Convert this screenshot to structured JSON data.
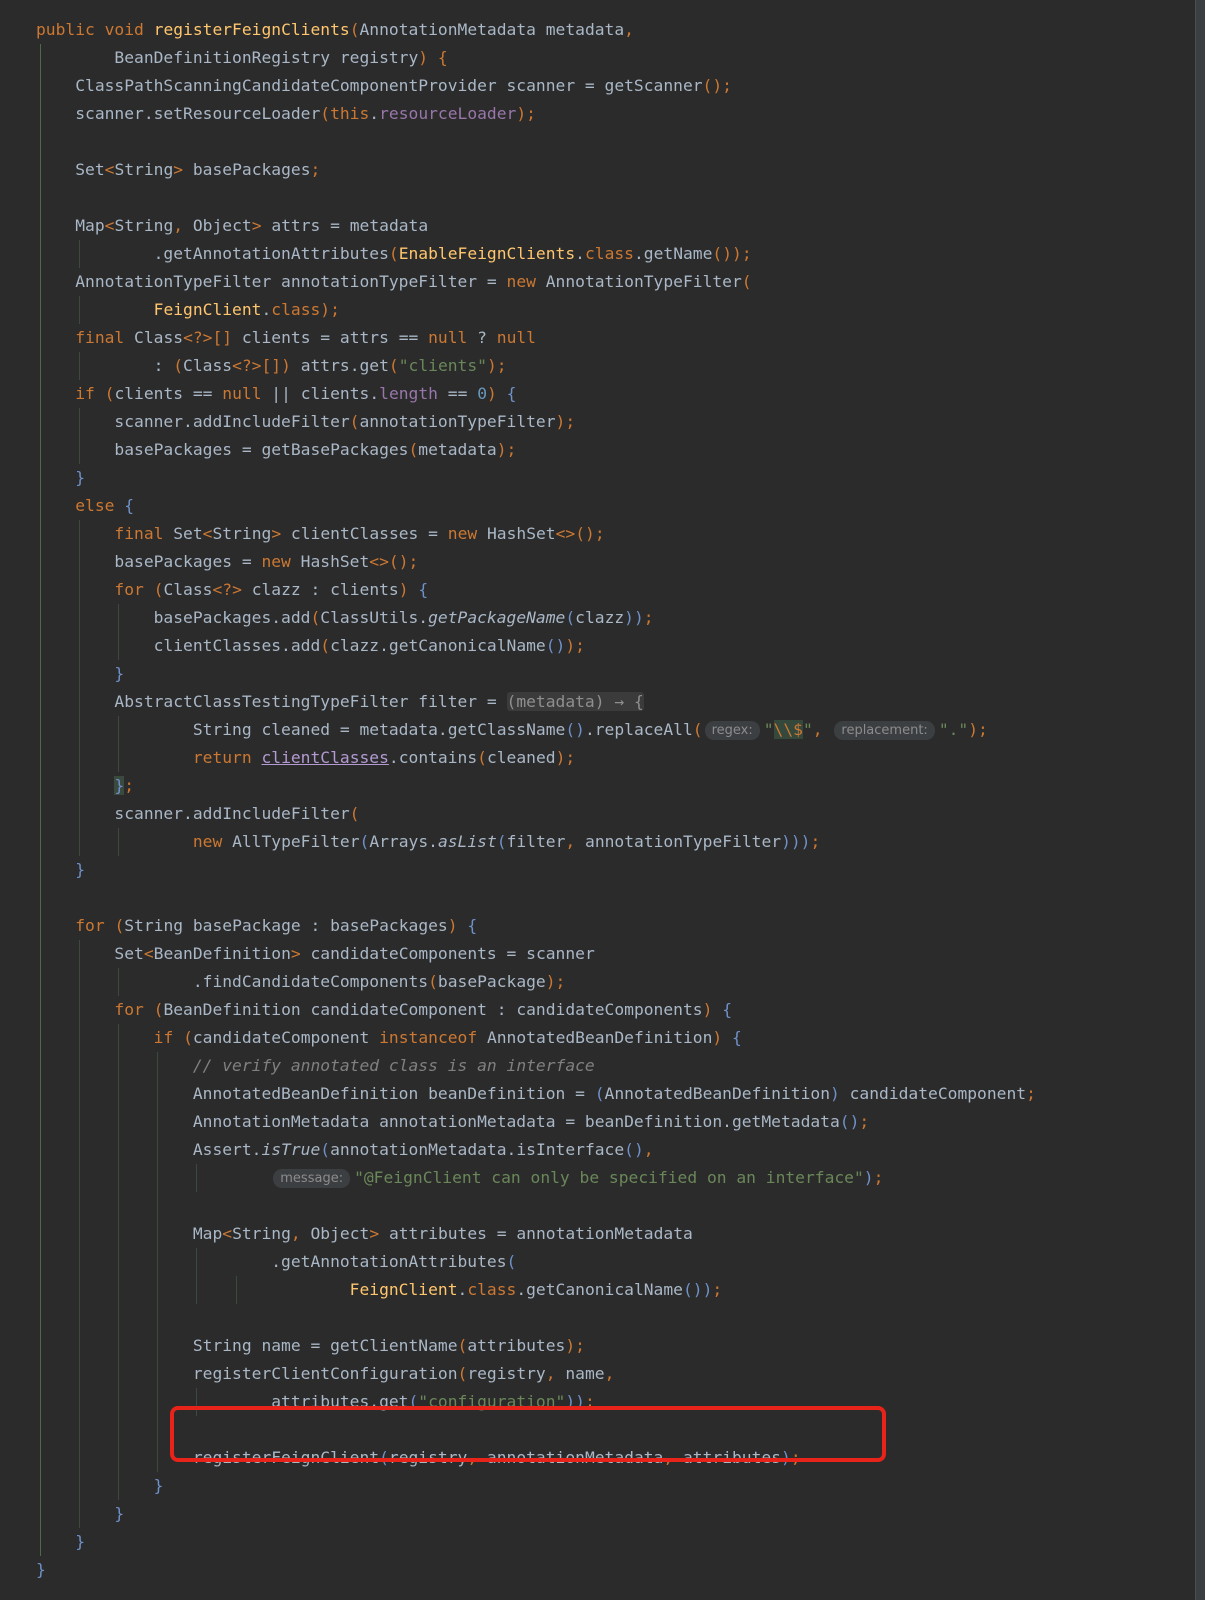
{
  "editor": {
    "theme_colors": {
      "background": "#2b2b2b",
      "keyword": "#cc7832",
      "method_declaration": "#ffc66d",
      "string": "#6a8759",
      "number": "#6897bb",
      "field": "#9876aa",
      "comment": "#808080",
      "default_text": "#a9b7c6",
      "highlight_box": "#e8241a"
    },
    "lines": [
      [
        {
          "t": "public void ",
          "c": "kw"
        },
        {
          "t": "registerFeignClients",
          "c": "fn"
        },
        {
          "t": "(",
          "c": "pc"
        },
        {
          "t": "AnnotationMetadata metadata",
          "c": ""
        },
        {
          "t": ",",
          "c": "pc"
        }
      ],
      [
        {
          "t": "        BeanDefinitionRegistry registry",
          "c": ""
        },
        {
          "t": ") {",
          "c": "pc"
        }
      ],
      [
        {
          "t": "    ClassPathScanningCandidateComponentProvider scanner = getScanner",
          "c": ""
        },
        {
          "t": "();",
          "c": "pc"
        }
      ],
      [
        {
          "t": "    scanner.setResourceLoader",
          "c": ""
        },
        {
          "t": "(",
          "c": "pc"
        },
        {
          "t": "this",
          "c": "kw"
        },
        {
          "t": ".",
          "c": ""
        },
        {
          "t": "resourceLoader",
          "c": "fld"
        },
        {
          "t": ");",
          "c": "pc"
        }
      ],
      [],
      [
        {
          "t": "    Set",
          "c": ""
        },
        {
          "t": "<",
          "c": "pc"
        },
        {
          "t": "String",
          "c": ""
        },
        {
          "t": ">",
          "c": "pc"
        },
        {
          "t": " basePackages",
          "c": ""
        },
        {
          "t": ";",
          "c": "pc"
        }
      ],
      [],
      [
        {
          "t": "    Map",
          "c": ""
        },
        {
          "t": "<",
          "c": "pc"
        },
        {
          "t": "String",
          "c": ""
        },
        {
          "t": ",",
          "c": "pc"
        },
        {
          "t": " Object",
          "c": ""
        },
        {
          "t": ">",
          "c": "pc"
        },
        {
          "t": " attrs = metadata",
          "c": ""
        }
      ],
      [
        {
          "t": "            .getAnnotationAttributes",
          "c": ""
        },
        {
          "t": "(",
          "c": "pc"
        },
        {
          "t": "EnableFeignClients",
          "c": "fn"
        },
        {
          "t": ".",
          "c": ""
        },
        {
          "t": "class",
          "c": "kw"
        },
        {
          "t": ".getName",
          "c": ""
        },
        {
          "t": "());",
          "c": "pc"
        }
      ],
      [
        {
          "t": "    AnnotationTypeFilter annotationTypeFilter = ",
          "c": ""
        },
        {
          "t": "new ",
          "c": "kw"
        },
        {
          "t": "AnnotationTypeFilter",
          "c": ""
        },
        {
          "t": "(",
          "c": "pc"
        }
      ],
      [
        {
          "t": "            ",
          "c": ""
        },
        {
          "t": "FeignClient",
          "c": "fn"
        },
        {
          "t": ".",
          "c": ""
        },
        {
          "t": "class",
          "c": "kw"
        },
        {
          "t": ");",
          "c": "pc"
        }
      ],
      [
        {
          "t": "    ",
          "c": ""
        },
        {
          "t": "final ",
          "c": "kw"
        },
        {
          "t": "Class",
          "c": ""
        },
        {
          "t": "<?>[]",
          "c": "pc"
        },
        {
          "t": " clients = attrs == ",
          "c": ""
        },
        {
          "t": "null",
          "c": "kw"
        },
        {
          "t": " ? ",
          "c": ""
        },
        {
          "t": "null",
          "c": "kw"
        }
      ],
      [
        {
          "t": "            : ",
          "c": ""
        },
        {
          "t": "(",
          "c": "pc"
        },
        {
          "t": "Class",
          "c": ""
        },
        {
          "t": "<?>[]",
          "c": "pc"
        },
        {
          "t": ")",
          "c": "pc"
        },
        {
          "t": " attrs.get",
          "c": ""
        },
        {
          "t": "(",
          "c": "pc"
        },
        {
          "t": "\"clients\"",
          "c": "str"
        },
        {
          "t": ");",
          "c": "pc"
        }
      ],
      [
        {
          "t": "    ",
          "c": ""
        },
        {
          "t": "if ",
          "c": "kw"
        },
        {
          "t": "(",
          "c": "pc"
        },
        {
          "t": "clients == ",
          "c": ""
        },
        {
          "t": "null",
          "c": "kw"
        },
        {
          "t": " || clients.",
          "c": ""
        },
        {
          "t": "length",
          "c": "fld"
        },
        {
          "t": " == ",
          "c": ""
        },
        {
          "t": "0",
          "c": "num"
        },
        {
          "t": ") ",
          "c": "pc"
        },
        {
          "t": "{",
          "c": "pb"
        }
      ],
      [
        {
          "t": "        scanner.addIncludeFilter",
          "c": ""
        },
        {
          "t": "(",
          "c": "pc"
        },
        {
          "t": "annotationTypeFilter",
          "c": ""
        },
        {
          "t": ");",
          "c": "pc"
        }
      ],
      [
        {
          "t": "        basePackages = getBasePackages",
          "c": ""
        },
        {
          "t": "(",
          "c": "pc"
        },
        {
          "t": "metadata",
          "c": ""
        },
        {
          "t": ");",
          "c": "pc"
        }
      ],
      [
        {
          "t": "    ",
          "c": ""
        },
        {
          "t": "}",
          "c": "pb"
        }
      ],
      [
        {
          "t": "    ",
          "c": ""
        },
        {
          "t": "else ",
          "c": "kw"
        },
        {
          "t": "{",
          "c": "pb"
        }
      ],
      [
        {
          "t": "        ",
          "c": ""
        },
        {
          "t": "final ",
          "c": "kw"
        },
        {
          "t": "Set",
          "c": ""
        },
        {
          "t": "<",
          "c": "pc"
        },
        {
          "t": "String",
          "c": ""
        },
        {
          "t": ">",
          "c": "pc"
        },
        {
          "t": " clientClasses = ",
          "c": ""
        },
        {
          "t": "new ",
          "c": "kw"
        },
        {
          "t": "HashSet",
          "c": ""
        },
        {
          "t": "<>();",
          "c": "pc"
        }
      ],
      [
        {
          "t": "        basePackages = ",
          "c": ""
        },
        {
          "t": "new ",
          "c": "kw"
        },
        {
          "t": "HashSet",
          "c": ""
        },
        {
          "t": "<>();",
          "c": "pc"
        }
      ],
      [
        {
          "t": "        ",
          "c": ""
        },
        {
          "t": "for ",
          "c": "kw"
        },
        {
          "t": "(",
          "c": "pc"
        },
        {
          "t": "Class",
          "c": ""
        },
        {
          "t": "<?>",
          "c": "pc"
        },
        {
          "t": " clazz : clients",
          "c": ""
        },
        {
          "t": ") ",
          "c": "pc"
        },
        {
          "t": "{",
          "c": "pb"
        }
      ],
      [
        {
          "t": "            basePackages.add",
          "c": ""
        },
        {
          "t": "(",
          "c": "pc"
        },
        {
          "t": "ClassUtils.",
          "c": ""
        },
        {
          "t": "getPackageName",
          "c": "it"
        },
        {
          "t": "(",
          "c": "pb"
        },
        {
          "t": "clazz",
          "c": ""
        },
        {
          "t": "))",
          "c": "pb"
        },
        {
          "t": ";",
          "c": "pc"
        }
      ],
      [
        {
          "t": "            clientClasses.add",
          "c": ""
        },
        {
          "t": "(",
          "c": "pc"
        },
        {
          "t": "clazz.getCanonicalName",
          "c": ""
        },
        {
          "t": "()",
          "c": "pb"
        },
        {
          "t": ");",
          "c": "pc"
        }
      ],
      [
        {
          "t": "        ",
          "c": ""
        },
        {
          "t": "}",
          "c": "pb"
        }
      ],
      [
        {
          "t": "        AbstractClassTestingTypeFilter filter = ",
          "c": ""
        },
        {
          "t": "(metadata) → {",
          "c": "lam"
        }
      ],
      [
        {
          "t": "                String cleaned = metadata.getClassName",
          "c": ""
        },
        {
          "t": "()",
          "c": "pb"
        },
        {
          "t": ".replaceAll",
          "c": ""
        },
        {
          "t": "(",
          "c": "pc"
        },
        {
          "h": "regex:"
        },
        {
          "t": "\"",
          "c": "str"
        },
        {
          "t": "\\\\$",
          "c": "esc"
        },
        {
          "t": "\"",
          "c": "str"
        },
        {
          "t": ", ",
          "c": "pc"
        },
        {
          "h": "replacement:"
        },
        {
          "t": "\".\"",
          "c": "str"
        },
        {
          "t": ");",
          "c": "pc"
        }
      ],
      [
        {
          "t": "                ",
          "c": ""
        },
        {
          "t": "return ",
          "c": "kw"
        },
        {
          "t": "clientClasses",
          "c": "ul"
        },
        {
          "t": ".contains",
          "c": ""
        },
        {
          "t": "(",
          "c": "pc"
        },
        {
          "t": "cleaned",
          "c": ""
        },
        {
          "t": ");",
          "c": "pc"
        }
      ],
      [
        {
          "t": "        ",
          "c": ""
        },
        {
          "t": "}",
          "c": "bh"
        },
        {
          "t": ";",
          "c": "pc"
        }
      ],
      [
        {
          "t": "        scanner.addIncludeFilter",
          "c": ""
        },
        {
          "t": "(",
          "c": "pc"
        }
      ],
      [
        {
          "t": "                ",
          "c": ""
        },
        {
          "t": "new ",
          "c": "kw"
        },
        {
          "t": "AllTypeFilter",
          "c": ""
        },
        {
          "t": "(",
          "c": "pb"
        },
        {
          "t": "Arrays.",
          "c": ""
        },
        {
          "t": "asList",
          "c": "it"
        },
        {
          "t": "(",
          "c": "pb"
        },
        {
          "t": "filter",
          "c": ""
        },
        {
          "t": ", ",
          "c": "pc"
        },
        {
          "t": "annotationTypeFilter",
          "c": ""
        },
        {
          "t": ")))",
          "c": "pb"
        },
        {
          "t": ";",
          "c": "pc"
        }
      ],
      [
        {
          "t": "    ",
          "c": ""
        },
        {
          "t": "}",
          "c": "pb"
        }
      ],
      [],
      [
        {
          "t": "    ",
          "c": ""
        },
        {
          "t": "for ",
          "c": "kw"
        },
        {
          "t": "(",
          "c": "pc"
        },
        {
          "t": "String basePackage : basePackages",
          "c": ""
        },
        {
          "t": ") ",
          "c": "pc"
        },
        {
          "t": "{",
          "c": "pb"
        }
      ],
      [
        {
          "t": "        Set",
          "c": ""
        },
        {
          "t": "<",
          "c": "pc"
        },
        {
          "t": "BeanDefinition",
          "c": ""
        },
        {
          "t": ">",
          "c": "pc"
        },
        {
          "t": " candidateComponents = scanner",
          "c": ""
        }
      ],
      [
        {
          "t": "                .findCandidateComponents",
          "c": ""
        },
        {
          "t": "(",
          "c": "pc"
        },
        {
          "t": "basePackage",
          "c": ""
        },
        {
          "t": ");",
          "c": "pc"
        }
      ],
      [
        {
          "t": "        ",
          "c": ""
        },
        {
          "t": "for ",
          "c": "kw"
        },
        {
          "t": "(",
          "c": "pc"
        },
        {
          "t": "BeanDefinition candidateComponent : candidateComponents",
          "c": ""
        },
        {
          "t": ") ",
          "c": "pc"
        },
        {
          "t": "{",
          "c": "pb"
        }
      ],
      [
        {
          "t": "            ",
          "c": ""
        },
        {
          "t": "if ",
          "c": "kw"
        },
        {
          "t": "(",
          "c": "pc"
        },
        {
          "t": "candidateComponent ",
          "c": ""
        },
        {
          "t": "instanceof ",
          "c": "kw"
        },
        {
          "t": "AnnotatedBeanDefinition",
          "c": ""
        },
        {
          "t": ") ",
          "c": "pc"
        },
        {
          "t": "{",
          "c": "pb"
        }
      ],
      [
        {
          "t": "                ",
          "c": ""
        },
        {
          "t": "// verify annotated class is an interface",
          "c": "cm"
        }
      ],
      [
        {
          "t": "                AnnotatedBeanDefinition beanDefinition = ",
          "c": ""
        },
        {
          "t": "(",
          "c": "pb"
        },
        {
          "t": "AnnotatedBeanDefinition",
          "c": ""
        },
        {
          "t": ")",
          "c": "pb"
        },
        {
          "t": " candidateComponent",
          "c": ""
        },
        {
          "t": ";",
          "c": "pc"
        }
      ],
      [
        {
          "t": "                AnnotationMetadata annotationMetadata = beanDefinition.getMetadata",
          "c": ""
        },
        {
          "t": "()",
          "c": "pb"
        },
        {
          "t": ";",
          "c": "pc"
        }
      ],
      [
        {
          "t": "                Assert.",
          "c": ""
        },
        {
          "t": "isTrue",
          "c": "it"
        },
        {
          "t": "(",
          "c": "pb"
        },
        {
          "t": "annotationMetadata.isInterface",
          "c": ""
        },
        {
          "t": "()",
          "c": "pb"
        },
        {
          "t": ",",
          "c": "pc"
        }
      ],
      [
        {
          "t": "                        ",
          "c": ""
        },
        {
          "h": "message:"
        },
        {
          "t": "\"@FeignClient can only be specified on an interface\"",
          "c": "str"
        },
        {
          "t": ")",
          "c": "pb"
        },
        {
          "t": ";",
          "c": "pc"
        }
      ],
      [],
      [
        {
          "t": "                Map",
          "c": ""
        },
        {
          "t": "<",
          "c": "pc"
        },
        {
          "t": "String",
          "c": ""
        },
        {
          "t": ",",
          "c": "pc"
        },
        {
          "t": " Object",
          "c": ""
        },
        {
          "t": ">",
          "c": "pc"
        },
        {
          "t": " attributes = annotationMetadata",
          "c": ""
        }
      ],
      [
        {
          "t": "                        .getAnnotationAttributes",
          "c": ""
        },
        {
          "t": "(",
          "c": "pb"
        }
      ],
      [
        {
          "t": "                                ",
          "c": ""
        },
        {
          "t": "FeignClient",
          "c": "fn"
        },
        {
          "t": ".",
          "c": ""
        },
        {
          "t": "class",
          "c": "kw"
        },
        {
          "t": ".getCanonicalName",
          "c": ""
        },
        {
          "t": "()",
          "c": "pb"
        },
        {
          "t": ")",
          "c": "pb"
        },
        {
          "t": ";",
          "c": "pc"
        }
      ],
      [],
      [
        {
          "t": "                String name = getClientName",
          "c": ""
        },
        {
          "t": "(",
          "c": "pc"
        },
        {
          "t": "attributes",
          "c": ""
        },
        {
          "t": ");",
          "c": "pc"
        }
      ],
      [
        {
          "t": "                registerClientConfiguration",
          "c": ""
        },
        {
          "t": "(",
          "c": "pc"
        },
        {
          "t": "registry",
          "c": ""
        },
        {
          "t": ", ",
          "c": "pc"
        },
        {
          "t": "name",
          "c": ""
        },
        {
          "t": ",",
          "c": "pc"
        }
      ],
      [
        {
          "t": "                        attributes.get",
          "c": ""
        },
        {
          "t": "(",
          "c": "pb"
        },
        {
          "t": "\"configuration\"",
          "c": "str"
        },
        {
          "t": "))",
          "c": "pb"
        },
        {
          "t": ";",
          "c": "pc"
        }
      ],
      [],
      [
        {
          "t": "                registerFeignClient",
          "c": ""
        },
        {
          "t": "(",
          "c": "pb"
        },
        {
          "t": "registry",
          "c": ""
        },
        {
          "t": ", ",
          "c": "pc"
        },
        {
          "t": "annotationMetadata",
          "c": ""
        },
        {
          "t": ", ",
          "c": "pc"
        },
        {
          "t": "attributes",
          "c": ""
        },
        {
          "t": ")",
          "c": "pb"
        },
        {
          "t": ";",
          "c": "pc"
        }
      ],
      [
        {
          "t": "            ",
          "c": ""
        },
        {
          "t": "}",
          "c": "pb"
        }
      ],
      [
        {
          "t": "        ",
          "c": ""
        },
        {
          "t": "}",
          "c": "pb"
        }
      ],
      [
        {
          "t": "    ",
          "c": ""
        },
        {
          "t": "}",
          "c": "pb"
        }
      ],
      [
        {
          "t": "}",
          "c": "pb"
        }
      ]
    ]
  }
}
